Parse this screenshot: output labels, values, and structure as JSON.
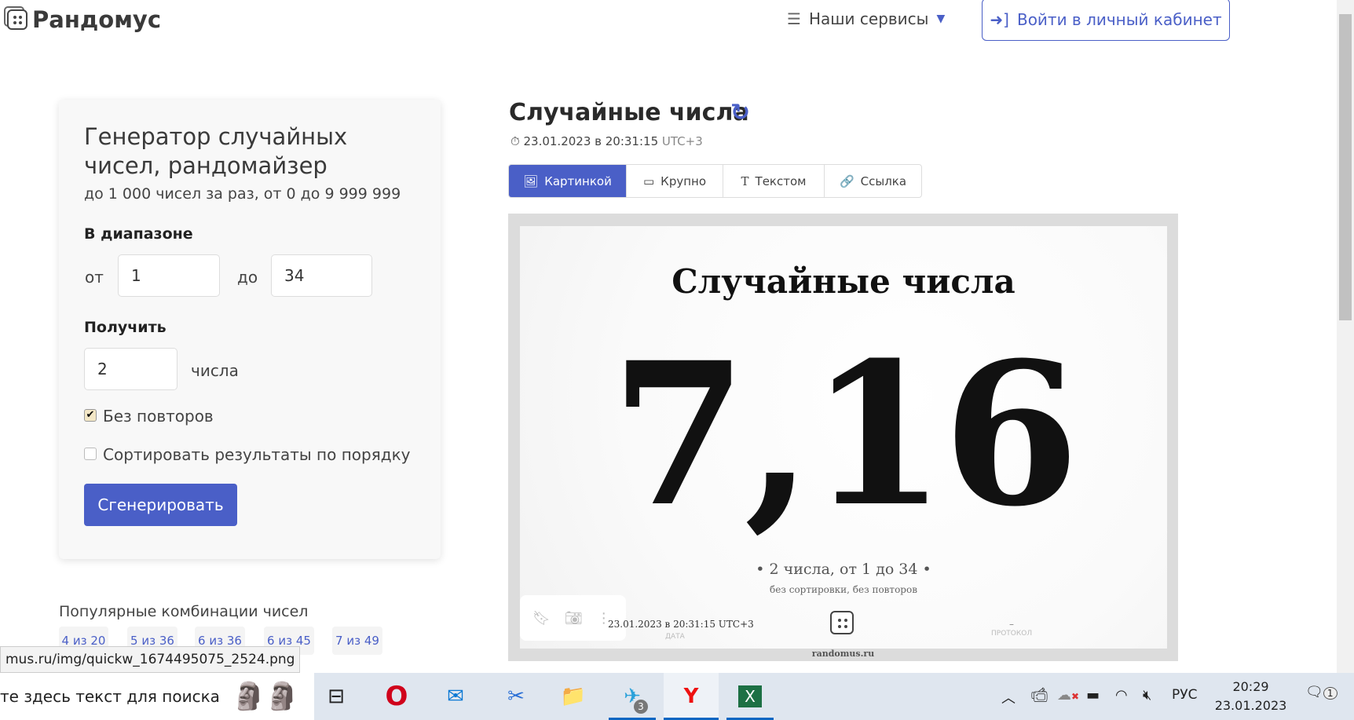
{
  "header": {
    "logo": "Рандомус",
    "services": "Наши сервисы",
    "login": "Войти в личный кабинет"
  },
  "form": {
    "title": "Генератор случайных чисел, рандомайзер",
    "subtitle": "до 1 000 чисел за раз, от 0 до 9 999 999",
    "range_label": "В диапазоне",
    "from_label": "от",
    "from_value": "1",
    "to_label": "до",
    "to_value": "34",
    "get_label": "Получить",
    "count_value": "2",
    "count_unit": "числа",
    "no_repeat_label": "Без повторов",
    "no_repeat_checked": true,
    "sort_label": "Сортировать результаты по порядку",
    "sort_checked": false,
    "generate": "Сгенерировать"
  },
  "popular": {
    "title": "Популярные комбинации чисел",
    "items": [
      "4 из 20",
      "5 из 36",
      "6 из 36",
      "6 из 45",
      "7 из 49"
    ]
  },
  "status_url": "mus.ru/img/quickw_1674495075_2524.png",
  "result": {
    "title": "Случайные числа",
    "timestamp": "23.01.2023 в 20:31:15",
    "tz": "UTC+3",
    "tabs": [
      "Картинкой",
      "Крупно",
      "Текстом",
      "Ссылка"
    ],
    "image": {
      "title": "Случайные числа",
      "numbers": "7,16",
      "summary": "• 2 числа, от 1 до 34 •",
      "details": "без сортировки, без повторов",
      "date": "23.01.2023 в 20:31:15 UTC+3",
      "date_label": "ДАТА",
      "protocol_value": "–",
      "protocol_label": "ПРОТОКОЛ",
      "site": "randomus.ru"
    }
  },
  "taskbar": {
    "search": "те здесь текст для поиска",
    "telegram_badge": "3",
    "lang": "РУС",
    "time": "20:29",
    "date": "23.01.2023",
    "notif_count": "1"
  },
  "colors": {
    "accent": "#4a5fc7"
  }
}
